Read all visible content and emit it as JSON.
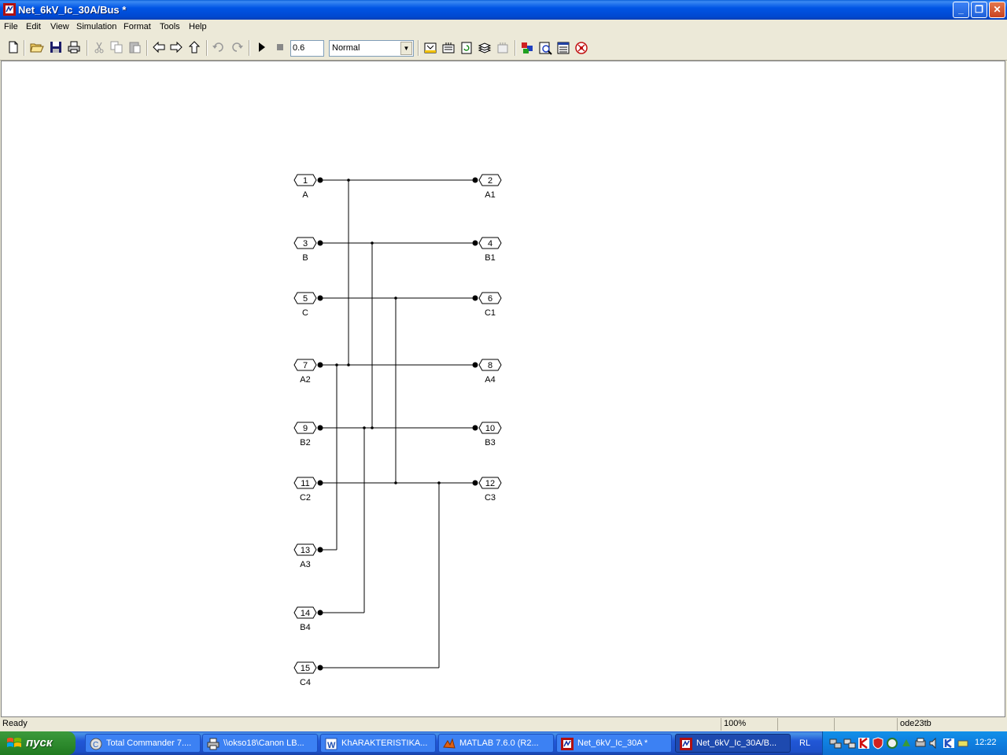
{
  "window": {
    "title": "Net_6kV_Ic_30A/Bus *"
  },
  "menu": [
    "File",
    "Edit",
    "View",
    "Simulation",
    "Format",
    "Tools",
    "Help"
  ],
  "toolbar": {
    "stop_time": "0.6",
    "sim_mode": "Normal"
  },
  "diagram": {
    "left_ports": [
      {
        "num": "1",
        "label": "A"
      },
      {
        "num": "3",
        "label": "B"
      },
      {
        "num": "5",
        "label": "C"
      },
      {
        "num": "7",
        "label": "A2"
      },
      {
        "num": "9",
        "label": "B2"
      },
      {
        "num": "11",
        "label": "C2"
      },
      {
        "num": "13",
        "label": "A3"
      },
      {
        "num": "14",
        "label": "B4"
      },
      {
        "num": "15",
        "label": "C4"
      }
    ],
    "right_ports": [
      {
        "num": "2",
        "label": "A1"
      },
      {
        "num": "4",
        "label": "B1"
      },
      {
        "num": "6",
        "label": "C1"
      },
      {
        "num": "8",
        "label": "A4"
      },
      {
        "num": "10",
        "label": "B3"
      },
      {
        "num": "12",
        "label": "C3"
      }
    ]
  },
  "statusbar": {
    "status": "Ready",
    "zoom": "100%",
    "solver": "ode23tb"
  },
  "taskbar": {
    "start_label": "пуск",
    "tasks": [
      {
        "label": "Total Commander 7...."
      },
      {
        "label": "\\\\okso18\\Canon LB..."
      },
      {
        "label": "KhARAKTERISTIKA..."
      },
      {
        "label": "MATLAB  7.6.0 (R2..."
      },
      {
        "label": "Net_6kV_Ic_30A *"
      },
      {
        "label": "Net_6kV_Ic_30A/B..."
      }
    ],
    "language": "RL",
    "clock": "12:22"
  }
}
